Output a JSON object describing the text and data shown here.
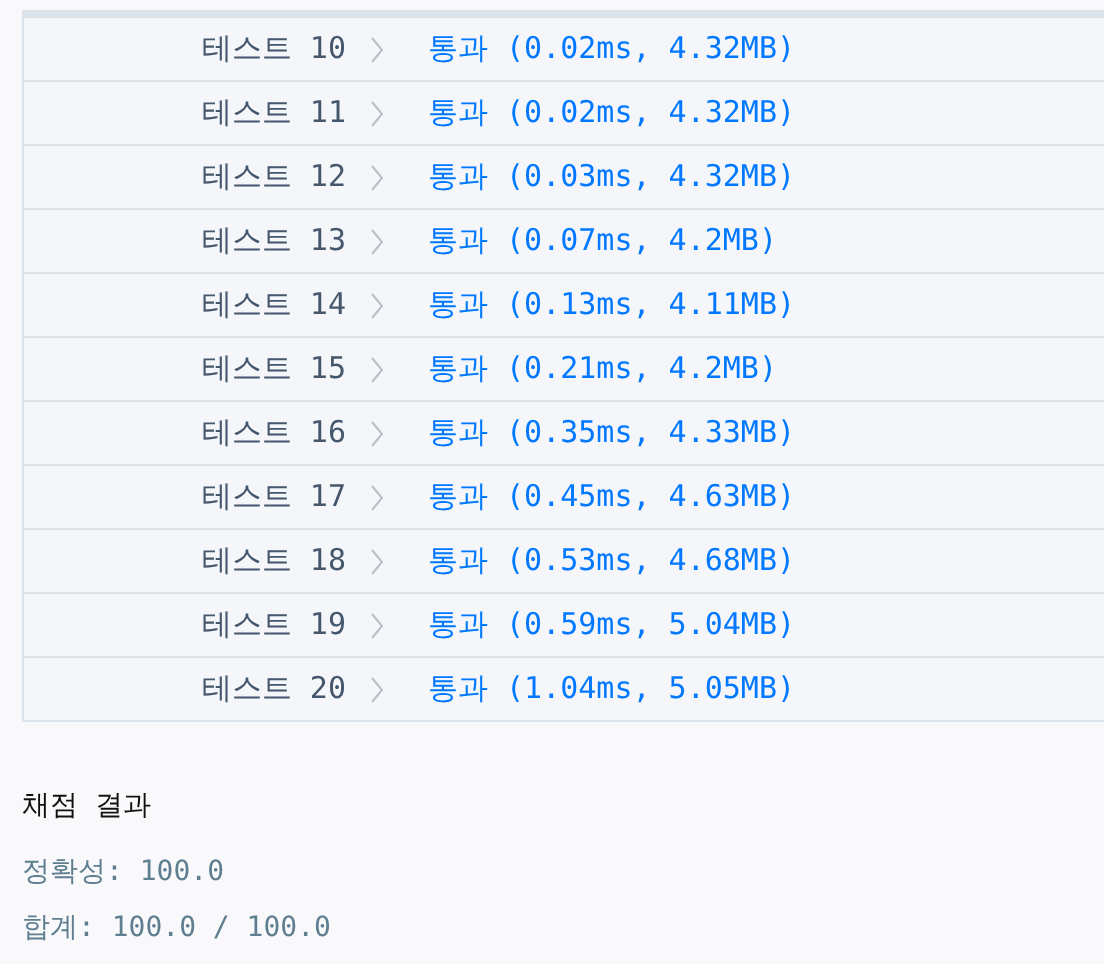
{
  "tests": [
    {
      "label": "테스트 10",
      "result": "통과 (0.02ms, 4.32MB)"
    },
    {
      "label": "테스트 11",
      "result": "통과 (0.02ms, 4.32MB)"
    },
    {
      "label": "테스트 12",
      "result": "통과 (0.03ms, 4.32MB)"
    },
    {
      "label": "테스트 13",
      "result": "통과 (0.07ms, 4.2MB)"
    },
    {
      "label": "테스트 14",
      "result": "통과 (0.13ms, 4.11MB)"
    },
    {
      "label": "테스트 15",
      "result": "통과 (0.21ms, 4.2MB)"
    },
    {
      "label": "테스트 16",
      "result": "통과 (0.35ms, 4.33MB)"
    },
    {
      "label": "테스트 17",
      "result": "통과 (0.45ms, 4.63MB)"
    },
    {
      "label": "테스트 18",
      "result": "통과 (0.53ms, 4.68MB)"
    },
    {
      "label": "테스트 19",
      "result": "통과 (0.59ms, 5.04MB)"
    },
    {
      "label": "테스트 20",
      "result": "통과 (1.04ms, 5.05MB)"
    }
  ],
  "summary": {
    "title": "채점 결과",
    "lines": [
      "정확성: 100.0",
      "합계: 100.0 / 100.0"
    ]
  }
}
